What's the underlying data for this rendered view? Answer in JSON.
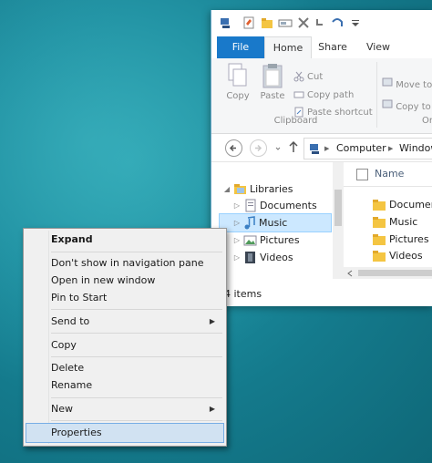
{
  "explorer": {
    "tabs": {
      "file": "File",
      "home": "Home",
      "share": "Share",
      "view": "View"
    },
    "ribbon": {
      "copy": "Copy",
      "paste": "Paste",
      "cut": "Cut",
      "copy_path": "Copy path",
      "paste_shortcut": "Paste shortcut",
      "clipboard_group": "Clipboard",
      "move_to": "Move to",
      "copy_to": "Copy to",
      "organize_group_partial": "Or"
    },
    "address": {
      "crumb1": "Computer",
      "sep": "▶",
      "crumb2": "Windows"
    },
    "nav_pane": {
      "libraries": "Libraries",
      "documents": "Documents",
      "music": "Music",
      "pictures": "Pictures",
      "videos": "Videos"
    },
    "content": {
      "column_name": "Name",
      "files": [
        "Documents",
        "Music",
        "Pictures",
        "Videos"
      ]
    },
    "status": "4 items"
  },
  "context_menu": {
    "expand": "Expand",
    "dont_show": "Don't show in navigation pane",
    "open_new_window": "Open in new window",
    "pin_to_start": "Pin to Start",
    "send_to": "Send to",
    "copy": "Copy",
    "delete": "Delete",
    "rename": "Rename",
    "new": "New",
    "properties": "Properties",
    "submenu_arrow": "▶"
  },
  "colors": {
    "file_tab": "#1979ca",
    "selection": "#cce8ff",
    "menu_highlight": "#d1e2f2",
    "desktop": "#1a8a9c"
  }
}
